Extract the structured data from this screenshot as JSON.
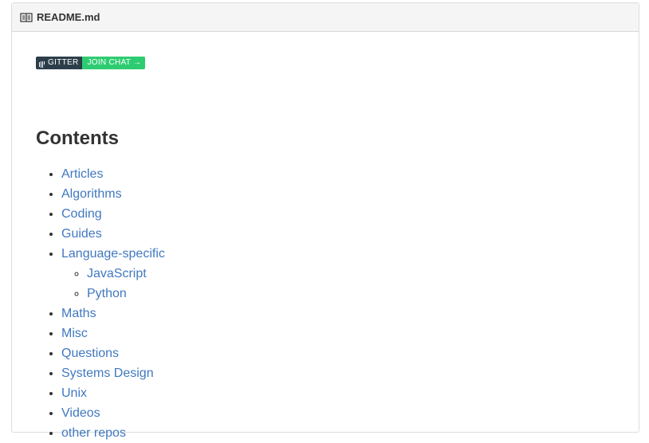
{
  "readme": {
    "title": "README.md",
    "icon": "book-icon"
  },
  "badge": {
    "left_label": "GITTER",
    "right_label": "JOIN CHAT →",
    "left_color": "#2c3e4a",
    "right_color": "#2ecc71"
  },
  "contents": {
    "heading": "Contents",
    "link_color": "#4078c0",
    "items": [
      {
        "label": "Articles"
      },
      {
        "label": "Algorithms"
      },
      {
        "label": "Coding"
      },
      {
        "label": "Guides"
      },
      {
        "label": "Language-specific",
        "children": [
          {
            "label": "JavaScript"
          },
          {
            "label": "Python"
          }
        ]
      },
      {
        "label": "Maths"
      },
      {
        "label": "Misc"
      },
      {
        "label": "Questions"
      },
      {
        "label": "Systems Design"
      },
      {
        "label": "Unix"
      },
      {
        "label": "Videos"
      },
      {
        "label": "other repos"
      }
    ]
  }
}
